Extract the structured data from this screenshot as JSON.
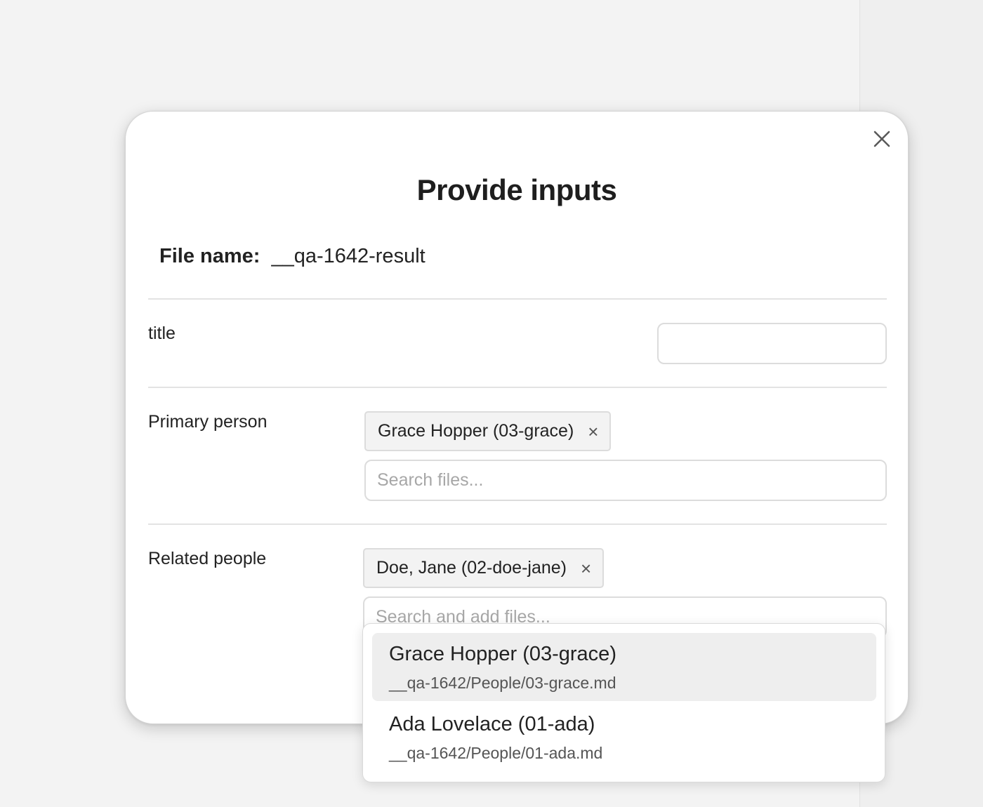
{
  "dialog": {
    "title": "Provide inputs",
    "close_icon": "close-icon",
    "file_name_label": "File name:",
    "file_name_value": "__qa-1642-result"
  },
  "fields": {
    "title": {
      "label": "title",
      "value": ""
    },
    "primary_person": {
      "label": "Primary person",
      "chip": "Grace Hopper (03-grace)",
      "chip_remove": "×",
      "search_placeholder": "Search files..."
    },
    "related_people": {
      "label": "Related people",
      "chip": "Doe, Jane (02-doe-jane)",
      "chip_remove": "×",
      "search_placeholder": "Search and add files..."
    }
  },
  "suggestions": [
    {
      "name": "Grace Hopper (03-grace)",
      "path": "__qa-1642/People/03-grace.md",
      "highlighted": true
    },
    {
      "name": "Ada Lovelace (01-ada)",
      "path": "__qa-1642/People/01-ada.md",
      "highlighted": false
    }
  ]
}
